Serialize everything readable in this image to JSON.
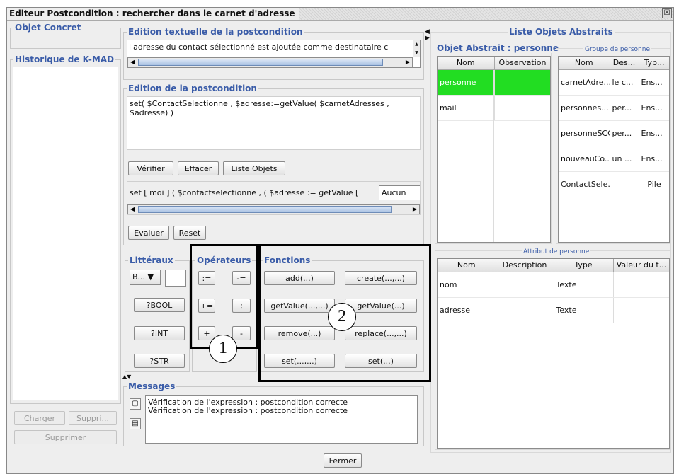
{
  "window": {
    "title": "Editeur Postcondition  : rechercher dans le carnet d'adresse",
    "close_glyph": "☒"
  },
  "left": {
    "objet_concret": "Objet Concret",
    "historique": "Historique de K-MAD",
    "charger": "Charger",
    "suppri": "Suppri...",
    "supprimer": "Supprimer"
  },
  "textual": {
    "title": "Edition textuelle de la postcondition",
    "text": "l'adresse du contact sélectionné est ajoutée comme destinataire c"
  },
  "edition": {
    "title": "Edition de la postcondition",
    "code": "set( $ContactSelectionne , $adresse:=getValue( $carnetAdresses , $adresse) )",
    "verifier": "Vérifier",
    "effacer": "Effacer",
    "liste_objets": "Liste Objets",
    "parsed": "set [ moi ] ( $contactselectionne , ( $adresse := getValue [",
    "parsed_combo": "Aucun",
    "evaluer": "Evaluer",
    "reset": "Reset"
  },
  "litteraux": {
    "title": "Littéraux",
    "combo": "B...",
    "buttons": [
      "?BOOL",
      "?INT",
      "?STR"
    ]
  },
  "operateurs": {
    "title": "Opérateurs",
    "buttons": [
      ":=",
      "-=",
      "+=",
      ";",
      "+",
      "-"
    ]
  },
  "fonctions": {
    "title": "Fonctions",
    "buttons": [
      "add(...)",
      "create(...,...)",
      "getValue(...,...)",
      "getValue(...)",
      "remove(...)",
      "replace(...,...)",
      "set(...,...)",
      "set(...)"
    ]
  },
  "messages": {
    "title": "Messages",
    "lines": [
      "Vérification de l'expression : postcondition correcte",
      "Vérification de l'expression : postcondition correcte"
    ]
  },
  "fermer": "Fermer",
  "liste_objets_abstraits": {
    "title": "Liste Objets Abstraits",
    "objet_abstrait": {
      "title": "Objet Abstrait : personne",
      "columns": [
        "Nom",
        "Observation"
      ],
      "rows": [
        [
          "personne",
          ""
        ],
        [
          "mail",
          ""
        ]
      ]
    },
    "groupe": {
      "title": "Groupe de personne",
      "columns": [
        "Nom",
        "Des...",
        "Typ..."
      ],
      "rows": [
        [
          "carnetAdre...",
          "le c...",
          "Ens..."
        ],
        [
          "personnes...",
          "per...",
          "Ens..."
        ],
        [
          "personneSCC",
          "per...",
          "Ens..."
        ],
        [
          "nouveauCo...",
          "un ...",
          "Ens..."
        ],
        [
          "ContactSele...",
          "",
          "Pile"
        ]
      ]
    },
    "attribut": {
      "title": "Attribut de personne",
      "columns": [
        "Nom",
        "Description",
        "Type",
        "Valeur du t..."
      ],
      "rows": [
        [
          "nom",
          "",
          "Texte",
          ""
        ],
        [
          "adresse",
          "",
          "Texte",
          ""
        ]
      ]
    }
  },
  "annotations": {
    "one": "1",
    "two": "2"
  },
  "colors": {
    "accent": "#3a5ca8",
    "selected_row": "#22dd22",
    "annotation": "#000000"
  }
}
